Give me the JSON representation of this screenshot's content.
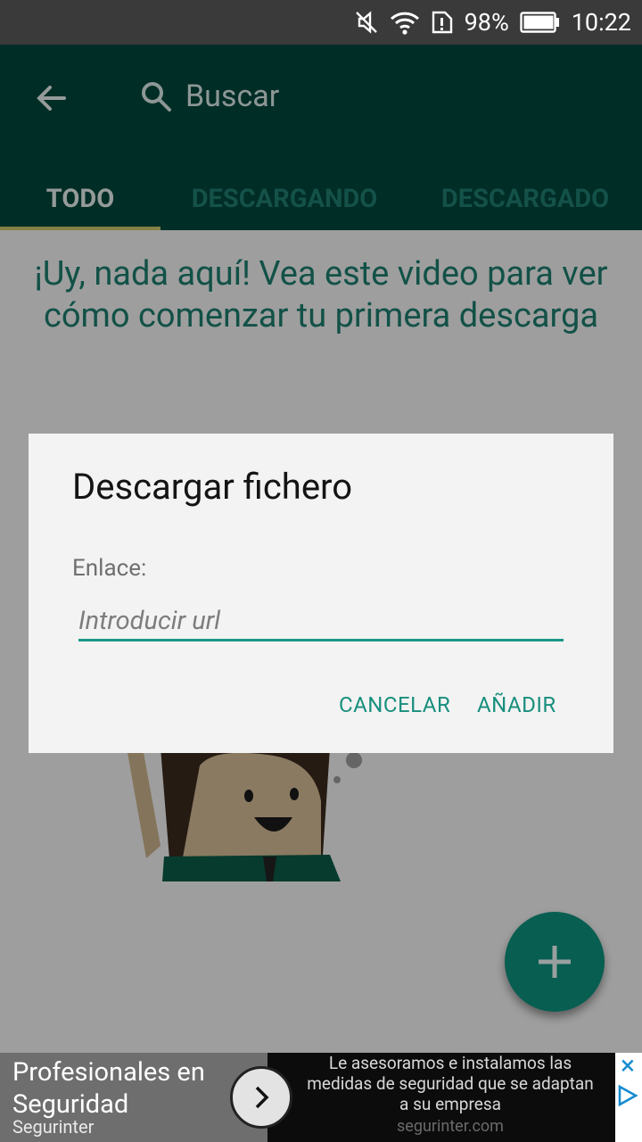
{
  "status_bar": {
    "battery": "98%",
    "time": "10:22"
  },
  "app_bar": {
    "back_icon": "arrow-back-icon",
    "search_placeholder": "Buscar"
  },
  "tabs": [
    {
      "label": "TODO",
      "active": true
    },
    {
      "label": "DESCARGANDO",
      "active": false
    },
    {
      "label": "DESCARGADO",
      "active": false
    }
  ],
  "empty_state": {
    "message": "¡Uy, nada aquí! Vea este video para ver cómo comenzar tu primera descarga"
  },
  "dialog": {
    "title": "Descargar fichero",
    "label": "Enlace:",
    "input_value": "",
    "input_placeholder": "Introducir url",
    "cancel_label": "CANCELAR",
    "add_label": "AÑADIR"
  },
  "fab": {
    "icon": "plus-icon"
  },
  "ad": {
    "title": "Profesionales en Seguridad",
    "brand": "Segurinter",
    "description": "Le asesoramos e instalamos las medidas de seguridad que se adaptan a su empresa",
    "url": "segurinter.com"
  },
  "colors": {
    "primary": "#00453a",
    "accent": "#1a9786",
    "indicator": "#c9c46b"
  }
}
